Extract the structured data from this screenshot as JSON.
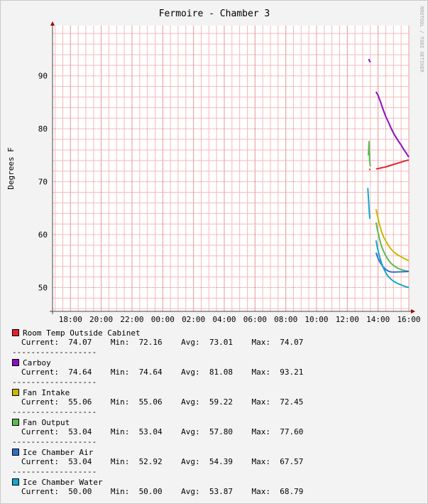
{
  "chart_data": {
    "type": "line",
    "title": "Fermoire - Chamber 3",
    "ylabel": "Degrees F",
    "watermark": "RRDTOOL / TOBI OETIKER",
    "xlim": [
      "16:50",
      "16:00"
    ],
    "ylim": [
      45.5,
      99.5
    ],
    "x_ticks": [
      "18:00",
      "20:00",
      "22:00",
      "00:00",
      "02:00",
      "04:00",
      "06:00",
      "08:00",
      "10:00",
      "12:00",
      "14:00",
      "16:00"
    ],
    "y_ticks": [
      "50",
      "60",
      "70",
      "80",
      "90"
    ],
    "grid": true,
    "colors": {
      "grid_minor": "#f5b9b9",
      "grid_major": "#e08080",
      "axis": "#444444",
      "arrow": "#990000",
      "canvas": "#ffffff",
      "background": "#f3f3f3"
    },
    "series": [
      {
        "name": "Room Temp Outside Cabinet",
        "color": "#e3202a",
        "segments": [
          [
            [
              "13:25",
              72.3
            ],
            [
              "13:30",
              72.3
            ]
          ],
          [
            [
              "13:52",
              72.4
            ],
            [
              "14:10",
              72.6
            ],
            [
              "14:30",
              72.8
            ],
            [
              "14:50",
              73.1
            ],
            [
              "15:10",
              73.4
            ],
            [
              "15:30",
              73.7
            ],
            [
              "15:50",
              74.0
            ],
            [
              "16:00",
              74.07
            ]
          ]
        ],
        "legend": {
          "current": "74.07",
          "min": "72.16",
          "avg": "73.01",
          "max": "74.07"
        }
      },
      {
        "name": "Carboy",
        "color": "#8a0fc3",
        "segments": [
          [
            [
              "13:24",
              93.2
            ],
            [
              "13:27",
              92.8
            ],
            [
              "13:30",
              92.6
            ]
          ],
          [
            [
              "13:52",
              87.0
            ],
            [
              "14:00",
              86.3
            ],
            [
              "14:10",
              85.0
            ],
            [
              "14:20",
              83.6
            ],
            [
              "14:30",
              82.3
            ],
            [
              "14:40",
              81.3
            ],
            [
              "14:50",
              80.2
            ],
            [
              "15:00",
              79.2
            ],
            [
              "15:10",
              78.4
            ],
            [
              "15:20",
              77.6
            ],
            [
              "15:30",
              76.9
            ],
            [
              "15:40",
              76.1
            ],
            [
              "15:50",
              75.4
            ],
            [
              "16:00",
              74.64
            ]
          ]
        ],
        "legend": {
          "current": "74.64",
          "min": "74.64",
          "avg": "81.08",
          "max": "93.21"
        }
      },
      {
        "name": "Fan Intake",
        "color": "#c9b800",
        "segments": [
          [
            [
              "13:52",
              64.8
            ],
            [
              "13:58",
              63.5
            ],
            [
              "14:05",
              62.0
            ],
            [
              "14:12",
              60.8
            ],
            [
              "14:20",
              59.7
            ],
            [
              "14:30",
              58.8
            ],
            [
              "14:40",
              58.0
            ],
            [
              "14:50",
              57.3
            ],
            [
              "15:00",
              56.8
            ],
            [
              "15:15",
              56.2
            ],
            [
              "15:30",
              55.8
            ],
            [
              "15:45",
              55.4
            ],
            [
              "16:00",
              55.06
            ]
          ]
        ],
        "legend": {
          "current": "55.06",
          "min": "55.06",
          "avg": "59.22",
          "max": "72.45"
        }
      },
      {
        "name": "Fan Output",
        "color": "#5abb54",
        "segments": [
          [
            [
              "13:22",
              75.0
            ],
            [
              "13:25",
              77.6
            ],
            [
              "13:27",
              74.0
            ],
            [
              "13:30",
              72.9
            ]
          ],
          [
            [
              "13:52",
              62.3
            ],
            [
              "13:58",
              60.8
            ],
            [
              "14:05",
              59.3
            ],
            [
              "14:12",
              58.0
            ],
            [
              "14:20",
              57.0
            ],
            [
              "14:30",
              56.0
            ],
            [
              "14:40",
              55.2
            ],
            [
              "14:50",
              54.6
            ],
            [
              "15:00",
              54.2
            ],
            [
              "15:15",
              53.7
            ],
            [
              "15:30",
              53.4
            ],
            [
              "15:45",
              53.2
            ],
            [
              "16:00",
              53.04
            ]
          ]
        ],
        "legend": {
          "current": "53.04",
          "min": "53.04",
          "avg": "57.80",
          "max": "77.60"
        }
      },
      {
        "name": "Ice Chamber Air",
        "color": "#2e6fd0",
        "segments": [
          [
            [
              "13:52",
              56.6
            ],
            [
              "14:00",
              55.5
            ],
            [
              "14:10",
              54.6
            ],
            [
              "14:20",
              53.9
            ],
            [
              "14:30",
              53.4
            ],
            [
              "14:40",
              53.1
            ],
            [
              "14:50",
              52.95
            ],
            [
              "15:00",
              52.92
            ],
            [
              "15:20",
              52.95
            ],
            [
              "15:40",
              53.0
            ],
            [
              "16:00",
              53.04
            ]
          ]
        ],
        "legend": {
          "current": "53.04",
          "min": "52.92",
          "avg": "54.39",
          "max": "67.57"
        }
      },
      {
        "name": "Ice Chamber Water",
        "color": "#12a8c8",
        "segments": [
          [
            [
              "13:20",
              68.8
            ],
            [
              "13:23",
              66.5
            ],
            [
              "13:26",
              64.0
            ],
            [
              "13:28",
              63.0
            ]
          ],
          [
            [
              "13:52",
              58.9
            ],
            [
              "13:58",
              57.4
            ],
            [
              "14:05",
              56.0
            ],
            [
              "14:12",
              54.8
            ],
            [
              "14:20",
              53.8
            ],
            [
              "14:30",
              52.8
            ],
            [
              "14:40",
              52.1
            ],
            [
              "14:50",
              51.6
            ],
            [
              "15:00",
              51.2
            ],
            [
              "15:15",
              50.8
            ],
            [
              "15:30",
              50.5
            ],
            [
              "15:45",
              50.2
            ],
            [
              "16:00",
              50.0
            ]
          ]
        ],
        "legend": {
          "current": "50.00",
          "min": "50.00",
          "avg": "53.87",
          "max": "68.79"
        }
      }
    ]
  },
  "legend_labels": {
    "current": "Current:",
    "min": "Min:",
    "avg": "Avg:",
    "max": "Max:",
    "separator": "------------------"
  }
}
